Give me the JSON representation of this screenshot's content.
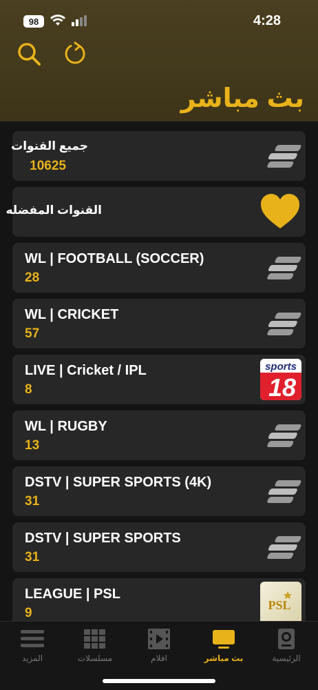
{
  "status": {
    "battery": "98",
    "time": "4:28"
  },
  "header": {
    "title": "بث مباشر"
  },
  "icons": {
    "search": "search-icon",
    "refresh": "refresh-icon"
  },
  "colors": {
    "accent": "#e8b21a",
    "card": "#272727",
    "background": "#141414"
  },
  "categories": [
    {
      "name": "جميع القنوات",
      "count": "10625",
      "icon": "stream-logo-icon"
    },
    {
      "name": "القنوات المفضله",
      "count": "",
      "icon": "heart-icon"
    },
    {
      "name": "WL | FOOTBALL (SOCCER)",
      "count": "28",
      "icon": "stream-logo-icon"
    },
    {
      "name": "WL | CRICKET",
      "count": "57",
      "icon": "stream-logo-icon"
    },
    {
      "name": "LIVE | Cricket / IPL",
      "count": "8",
      "icon": "sports18-logo"
    },
    {
      "name": "WL | RUGBY",
      "count": "13",
      "icon": "stream-logo-icon"
    },
    {
      "name": "DSTV | SUPER SPORTS (4K)",
      "count": "31",
      "icon": "stream-logo-icon"
    },
    {
      "name": "DSTV | SUPER SPORTS",
      "count": "31",
      "icon": "stream-logo-icon"
    },
    {
      "name": "LEAGUE | PSL",
      "count": "9",
      "icon": "psl-logo"
    }
  ],
  "logos": {
    "sports18_top": "sports",
    "sports18_num": "18",
    "psl": "PSL"
  },
  "tabs": [
    {
      "label": "المزيد",
      "icon": "menu-icon"
    },
    {
      "label": "مسلسلات",
      "icon": "grid-icon"
    },
    {
      "label": "افلام",
      "icon": "film-icon"
    },
    {
      "label": "بث مباشر",
      "icon": "tv-icon",
      "active": true
    },
    {
      "label": "الرئيسية",
      "icon": "home-icon"
    }
  ]
}
